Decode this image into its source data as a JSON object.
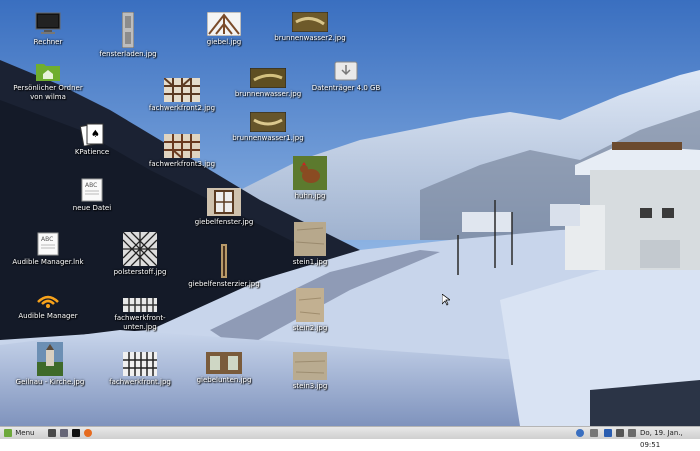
{
  "desktop": {
    "icons": [
      {
        "label": "Rechner",
        "icon": "computer-icon"
      },
      {
        "label": "Persönlicher Ordner von wilma",
        "icon": "home-folder-icon"
      },
      {
        "label": "KPatience",
        "icon": "cards-icon"
      },
      {
        "label": "neue Datei",
        "icon": "text-document-icon"
      },
      {
        "label": "Audible Manager.lnk",
        "icon": "text-document-icon"
      },
      {
        "label": "Audible Manager",
        "icon": "audible-icon"
      },
      {
        "label": "Geilnau - Kirche.jpg",
        "icon": "image-thumb-church"
      },
      {
        "label": "fensterladen.jpg",
        "icon": "image-thumb-shutter"
      },
      {
        "label": "fachwerkfront2.jpg",
        "icon": "image-thumb-timber"
      },
      {
        "label": "fachwerkfront3.jpg",
        "icon": "image-thumb-timber"
      },
      {
        "label": "polsterstoff.jpg",
        "icon": "image-thumb-fabric"
      },
      {
        "label": "fachwerkfront-unten.jpg",
        "icon": "image-thumb-timber"
      },
      {
        "label": "fachwerkfront.jpg",
        "icon": "image-thumb-timber"
      },
      {
        "label": "giebel.jpg",
        "icon": "image-thumb-gable"
      },
      {
        "label": "giebelfenster.jpg",
        "icon": "image-thumb-window"
      },
      {
        "label": "giebelfensterzier.jpg",
        "icon": "image-thumb-ornament"
      },
      {
        "label": "giebelunten.jpg",
        "icon": "image-thumb-gable-bottom"
      },
      {
        "label": "brunnenwasser2.jpg",
        "icon": "image-thumb-water"
      },
      {
        "label": "brunnenwasser.jpg",
        "icon": "image-thumb-water"
      },
      {
        "label": "brunnenwasser1.jpg",
        "icon": "image-thumb-water"
      },
      {
        "label": "huhn.jpg",
        "icon": "image-thumb-chicken"
      },
      {
        "label": "stein1.jpg",
        "icon": "image-thumb-stone"
      },
      {
        "label": "stein2.jpg",
        "icon": "image-thumb-stone"
      },
      {
        "label": "stein3.jpg",
        "icon": "image-thumb-stone"
      },
      {
        "label": "Datenträger 4.0 GB",
        "icon": "drive-icon"
      }
    ]
  },
  "taskbar": {
    "menu_label": "Menu",
    "clock": "Do, 19. Jan., 09:51",
    "launchers": [
      "show-desktop-icon",
      "terminal-icon",
      "files-icon",
      "firefox-icon"
    ],
    "tray": [
      "update-icon",
      "network-icon",
      "bluetooth-icon",
      "volume-icon",
      "battery-icon"
    ]
  },
  "colors": {
    "sky_top": "#3f77c6",
    "sky_bottom": "#b7d0ec",
    "snow": "#e9eff8",
    "mountain": "#20283a",
    "taskbar": "#dcdcdc"
  }
}
